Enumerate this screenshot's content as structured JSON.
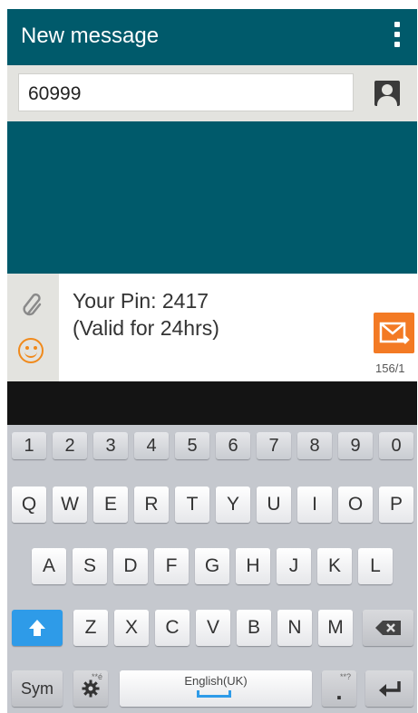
{
  "header": {
    "title": "New message"
  },
  "recipient": {
    "value": "60999"
  },
  "message": {
    "line1": "Your Pin: 2417",
    "line2": "(Valid for 24hrs)",
    "counter": "156/1"
  },
  "keyboard": {
    "numbers": [
      "1",
      "2",
      "3",
      "4",
      "5",
      "6",
      "7",
      "8",
      "9",
      "0"
    ],
    "row1": [
      "Q",
      "W",
      "E",
      "R",
      "T",
      "Y",
      "U",
      "I",
      "O",
      "P"
    ],
    "row2": [
      "A",
      "S",
      "D",
      "F",
      "G",
      "H",
      "J",
      "K",
      "L"
    ],
    "row3": [
      "Z",
      "X",
      "C",
      "V",
      "B",
      "N",
      "M"
    ],
    "sym_label": "Sym",
    "space_label": "English(UK)",
    "settings_hint": "**é",
    "period_hint": "**?",
    "period_label": "."
  },
  "colors": {
    "header": "#005a6b",
    "accent_orange": "#f37a24",
    "shift_blue": "#2e9be8"
  }
}
